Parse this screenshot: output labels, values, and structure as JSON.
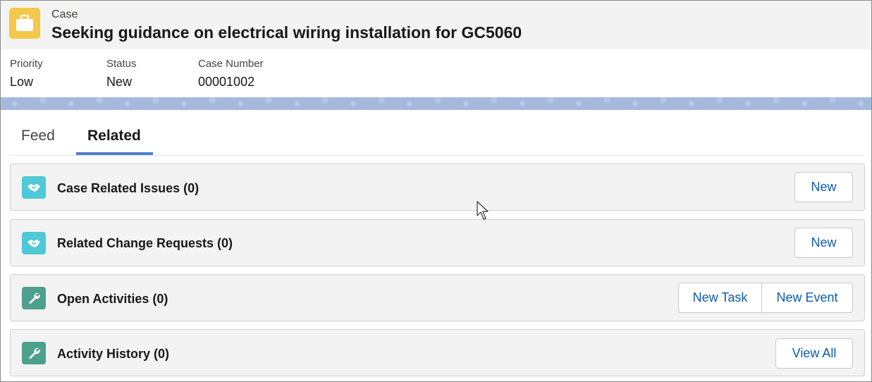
{
  "header": {
    "object_label": "Case",
    "title": "Seeking guidance on electrical wiring installation for GC5060",
    "icon": "briefcase-icon",
    "icon_color": "#f4c84a"
  },
  "highlights": [
    {
      "label": "Priority",
      "value": "Low"
    },
    {
      "label": "Status",
      "value": "New"
    },
    {
      "label": "Case Number",
      "value": "00001002"
    }
  ],
  "tabs": [
    {
      "label": "Feed",
      "active": false
    },
    {
      "label": "Related",
      "active": true
    }
  ],
  "related_lists": [
    {
      "title": "Case Related Issues (0)",
      "icon": "handshake-icon",
      "icon_color": "#4fc9d7",
      "buttons": [
        "New"
      ]
    },
    {
      "title": "Related Change Requests (0)",
      "icon": "handshake-icon",
      "icon_color": "#4fc9d7",
      "buttons": [
        "New"
      ]
    },
    {
      "title": "Open Activities (0)",
      "icon": "wrench-icon",
      "icon_color": "#4da08c",
      "buttons": [
        "New Task",
        "New Event"
      ]
    },
    {
      "title": "Activity History (0)",
      "icon": "wrench-icon",
      "icon_color": "#4da08c",
      "buttons": [
        "View All"
      ]
    }
  ],
  "colors": {
    "accent": "#4a7ed6",
    "link": "#0b5cab",
    "band": "#a5b9dd"
  }
}
